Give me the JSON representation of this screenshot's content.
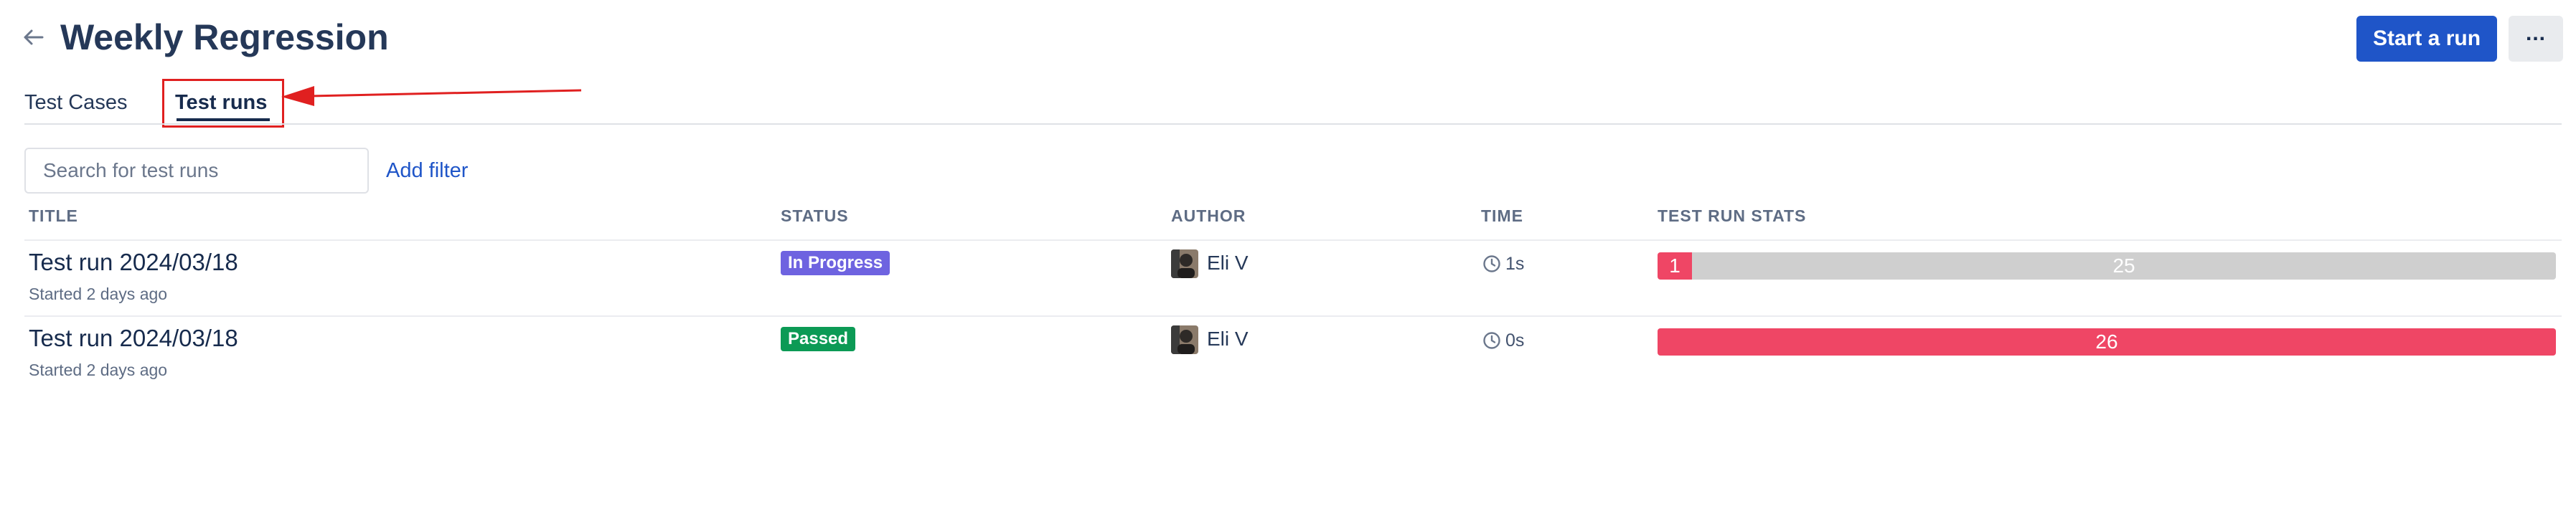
{
  "header": {
    "title": "Weekly Regression",
    "start_run_label": "Start a run",
    "more_label": "..."
  },
  "tabs": [
    {
      "label": "Test Cases",
      "active": false
    },
    {
      "label": "Test runs",
      "active": true
    }
  ],
  "toolbar": {
    "search_placeholder": "Search for test runs",
    "add_filter_label": "Add filter"
  },
  "table": {
    "columns": [
      "TITLE",
      "STATUS",
      "AUTHOR",
      "TIME",
      "TEST RUN STATS"
    ],
    "rows": [
      {
        "title": "Test run 2024/03/18",
        "subtitle": "Started 2 days ago",
        "status": "In Progress",
        "author": "Eli V",
        "time": "1s",
        "stats": {
          "failed": 1,
          "untested": 25
        }
      },
      {
        "title": "Test run 2024/03/18",
        "subtitle": "Started 2 days ago",
        "status": "Passed",
        "author": "Eli V",
        "time": "0s",
        "stats": {
          "failed": 26,
          "untested": 0
        }
      }
    ]
  },
  "colors": {
    "primary": "#1f55c8",
    "in_progress": "#6e63e0",
    "passed": "#0c9a55",
    "failed": "#ef4665",
    "untested": "#cfcfcf",
    "annotation": "#e02020"
  },
  "icons": {
    "back": "arrow-left-icon",
    "clock": "clock-icon",
    "more": "more-dots-icon"
  }
}
